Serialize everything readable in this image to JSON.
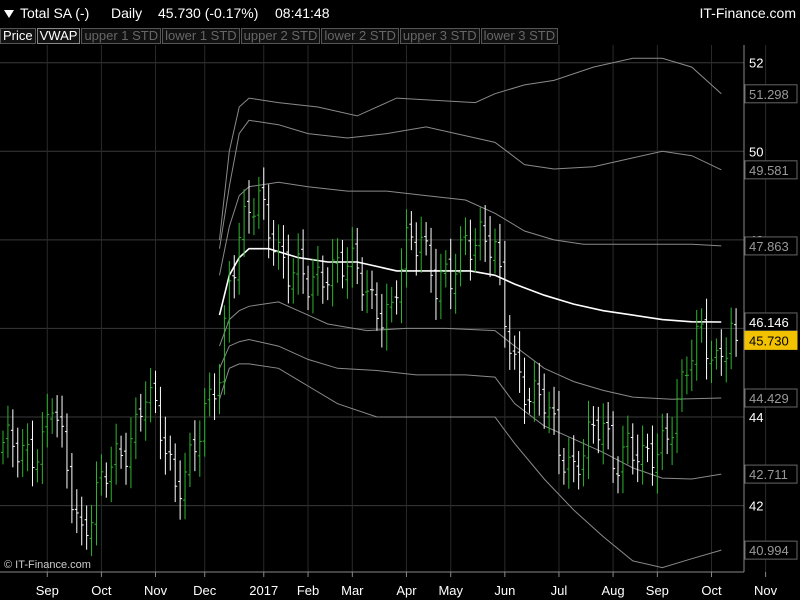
{
  "header": {
    "icon": "dropdown-arrow-icon",
    "symbol": "Total SA (-)",
    "period": "Daily",
    "price": "45.730 (-0.17%)",
    "time": "08:41:48",
    "brand": "IT-Finance.com"
  },
  "legend": [
    "Price",
    "VWAP",
    "upper 1 STD",
    "lower 1 STD",
    "upper 2 STD",
    "lower 2 STD",
    "upper 3 STD",
    "lower 3 STD"
  ],
  "credit": "© IT-Finance.com",
  "colors": {
    "up": "#2db52d",
    "down": "#ffffff",
    "vwap": "#ffffff",
    "band": "#8a8a8a",
    "last_price_bg": "#f2c200"
  },
  "chart_data": {
    "type": "candlestick",
    "y_ticks": [
      "52",
      "50",
      "48",
      "46",
      "44",
      "42"
    ],
    "y_tick_values": [
      52,
      50,
      48,
      46,
      44,
      42
    ],
    "ylim": [
      40.5,
      52.4
    ],
    "x_labels": [
      "Sep",
      "Oct",
      "Nov",
      "Dec",
      "2017",
      "Feb",
      "Mar",
      "Apr",
      "May",
      "Jun",
      "Jul",
      "Aug",
      "Sep",
      "Oct",
      "Nov"
    ],
    "x_label_index": [
      9,
      20,
      31,
      41,
      53,
      62,
      71,
      82,
      91,
      102,
      113,
      124,
      133,
      144,
      155
    ],
    "n_bars": 150,
    "close_key_points": [
      [
        0,
        43.2
      ],
      [
        8,
        43.4
      ],
      [
        10,
        44.2
      ],
      [
        13,
        42.8
      ],
      [
        16,
        41.5
      ],
      [
        18,
        41.9
      ],
      [
        22,
        42.8
      ],
      [
        27,
        43.9
      ],
      [
        29,
        44.5
      ],
      [
        33,
        43.3
      ],
      [
        35,
        42.6
      ],
      [
        39,
        43.2
      ],
      [
        42,
        44.2
      ],
      [
        44,
        45.1
      ],
      [
        46,
        47.2
      ],
      [
        48,
        48.1
      ],
      [
        52,
        48.8
      ],
      [
        55,
        48.2
      ],
      [
        58,
        47.3
      ],
      [
        62,
        46.9
      ],
      [
        66,
        47.5
      ],
      [
        70,
        47.3
      ],
      [
        73,
        47.1
      ],
      [
        76,
        46.6
      ],
      [
        79,
        46.2
      ],
      [
        82,
        47.8
      ],
      [
        85,
        48.3
      ],
      [
        88,
        47.0
      ],
      [
        91,
        46.9
      ],
      [
        94,
        48.1
      ],
      [
        97,
        48.2
      ],
      [
        100,
        47.6
      ],
      [
        102,
        46.1
      ],
      [
        104,
        45.3
      ],
      [
        107,
        44.6
      ],
      [
        110,
        44.2
      ],
      [
        113,
        43.3
      ],
      [
        116,
        43.0
      ],
      [
        119,
        43.4
      ],
      [
        122,
        43.7
      ],
      [
        124,
        43.1
      ],
      [
        127,
        43.5
      ],
      [
        130,
        42.8
      ],
      [
        133,
        43.2
      ],
      [
        136,
        44.1
      ],
      [
        139,
        45.0
      ],
      [
        142,
        45.8
      ],
      [
        145,
        45.4
      ],
      [
        148,
        46.0
      ],
      [
        149,
        45.73
      ]
    ],
    "series": [
      {
        "name": "VWAP",
        "values": [
          [
            44,
            46.3
          ],
          [
            46,
            47.2
          ],
          [
            48,
            47.6
          ],
          [
            50,
            47.8
          ],
          [
            54,
            47.8
          ],
          [
            60,
            47.6
          ],
          [
            66,
            47.5
          ],
          [
            72,
            47.5
          ],
          [
            80,
            47.3
          ],
          [
            86,
            47.3
          ],
          [
            95,
            47.3
          ],
          [
            100,
            47.2
          ],
          [
            104,
            47.0
          ],
          [
            110,
            46.75
          ],
          [
            116,
            46.55
          ],
          [
            122,
            46.4
          ],
          [
            128,
            46.3
          ],
          [
            134,
            46.2
          ],
          [
            140,
            46.15
          ],
          [
            146,
            46.146
          ]
        ]
      },
      {
        "name": "upper 1 STD",
        "values": [
          [
            44,
            47.2
          ],
          [
            46,
            48.3
          ],
          [
            48,
            49.0
          ],
          [
            50,
            49.2
          ],
          [
            56,
            49.3
          ],
          [
            62,
            49.2
          ],
          [
            70,
            49.1
          ],
          [
            78,
            49.1
          ],
          [
            86,
            49.0
          ],
          [
            94,
            48.9
          ],
          [
            100,
            48.6
          ],
          [
            106,
            48.2
          ],
          [
            112,
            48.0
          ],
          [
            118,
            47.9
          ],
          [
            126,
            47.9
          ],
          [
            134,
            47.9
          ],
          [
            140,
            47.9
          ],
          [
            146,
            47.863
          ]
        ]
      },
      {
        "name": "lower 1 STD",
        "values": [
          [
            44,
            45.6
          ],
          [
            46,
            46.2
          ],
          [
            48,
            46.4
          ],
          [
            50,
            46.5
          ],
          [
            56,
            46.6
          ],
          [
            62,
            46.3
          ],
          [
            66,
            46.1
          ],
          [
            74,
            45.95
          ],
          [
            82,
            46.0
          ],
          [
            90,
            46.0
          ],
          [
            100,
            45.95
          ],
          [
            104,
            45.6
          ],
          [
            110,
            45.1
          ],
          [
            116,
            44.8
          ],
          [
            122,
            44.6
          ],
          [
            128,
            44.45
          ],
          [
            136,
            44.4
          ],
          [
            146,
            44.429
          ]
        ]
      },
      {
        "name": "upper 2 STD",
        "values": [
          [
            44,
            47.8
          ],
          [
            46,
            49.2
          ],
          [
            48,
            50.4
          ],
          [
            50,
            50.7
          ],
          [
            56,
            50.6
          ],
          [
            62,
            50.4
          ],
          [
            70,
            50.3
          ],
          [
            78,
            50.4
          ],
          [
            86,
            50.55
          ],
          [
            94,
            50.35
          ],
          [
            100,
            50.2
          ],
          [
            106,
            49.7
          ],
          [
            112,
            49.6
          ],
          [
            120,
            49.65
          ],
          [
            128,
            49.85
          ],
          [
            134,
            50.0
          ],
          [
            140,
            49.9
          ],
          [
            146,
            49.581
          ]
        ]
      },
      {
        "name": "lower 2 STD",
        "values": [
          [
            44,
            45.1
          ],
          [
            46,
            45.6
          ],
          [
            48,
            45.7
          ],
          [
            50,
            45.75
          ],
          [
            56,
            45.6
          ],
          [
            62,
            45.3
          ],
          [
            68,
            45.1
          ],
          [
            76,
            45.05
          ],
          [
            84,
            44.95
          ],
          [
            94,
            44.95
          ],
          [
            100,
            44.9
          ],
          [
            104,
            44.3
          ],
          [
            110,
            43.8
          ],
          [
            116,
            43.5
          ],
          [
            122,
            43.2
          ],
          [
            128,
            42.85
          ],
          [
            134,
            42.62
          ],
          [
            140,
            42.6
          ],
          [
            146,
            42.711
          ]
        ]
      },
      {
        "name": "upper 3 STD",
        "values": [
          [
            44,
            48.0
          ],
          [
            46,
            50.0
          ],
          [
            48,
            51.0
          ],
          [
            50,
            51.2
          ],
          [
            56,
            51.1
          ],
          [
            64,
            51.0
          ],
          [
            72,
            50.8
          ],
          [
            80,
            51.2
          ],
          [
            88,
            51.15
          ],
          [
            96,
            51.1
          ],
          [
            100,
            51.3
          ],
          [
            106,
            51.5
          ],
          [
            112,
            51.6
          ],
          [
            120,
            51.9
          ],
          [
            128,
            52.1
          ],
          [
            134,
            52.1
          ],
          [
            140,
            51.9
          ],
          [
            146,
            51.298
          ]
        ]
      },
      {
        "name": "lower 3 STD",
        "values": [
          [
            44,
            44.4
          ],
          [
            46,
            45.1
          ],
          [
            48,
            45.2
          ],
          [
            50,
            45.2
          ],
          [
            56,
            45.1
          ],
          [
            62,
            44.7
          ],
          [
            68,
            44.3
          ],
          [
            76,
            44.0
          ],
          [
            84,
            44.0
          ],
          [
            92,
            44.0
          ],
          [
            100,
            44.0
          ],
          [
            104,
            43.4
          ],
          [
            110,
            42.6
          ],
          [
            116,
            41.9
          ],
          [
            122,
            41.3
          ],
          [
            128,
            40.75
          ],
          [
            134,
            40.6
          ],
          [
            140,
            40.8
          ],
          [
            146,
            40.994
          ]
        ]
      }
    ],
    "right_labels": [
      "51.298",
      "49.581",
      "47.863",
      "46.146",
      "45.730",
      "44.429",
      "42.711",
      "40.994"
    ],
    "right_label_values": [
      51.298,
      49.581,
      47.863,
      46.146,
      45.73,
      44.429,
      42.711,
      40.994
    ],
    "last_price": "45.730",
    "last_price_value": 45.73
  }
}
